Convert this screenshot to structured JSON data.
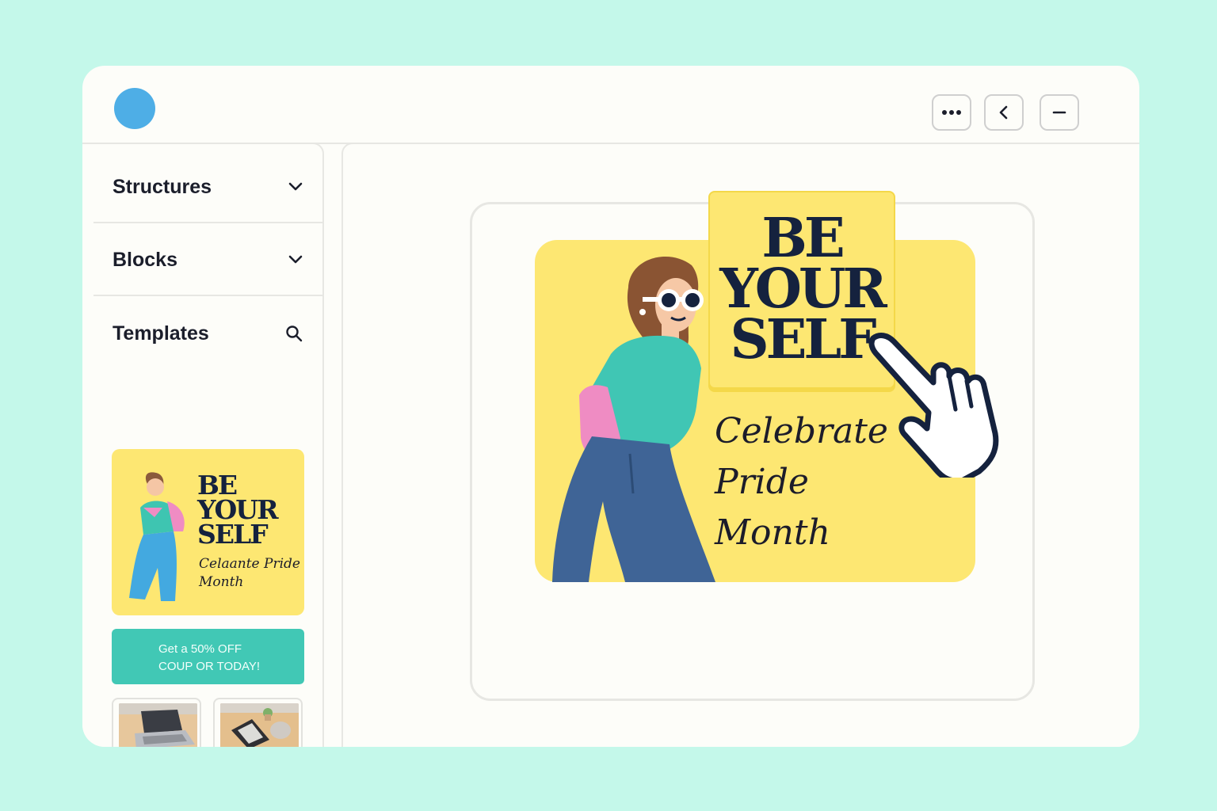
{
  "window": {
    "controls": [
      {
        "icon": "more-icon"
      },
      {
        "icon": "chevron-left-icon"
      },
      {
        "icon": "minus-icon"
      }
    ]
  },
  "sidebar": {
    "sections": [
      {
        "label": "Structures",
        "icon": "chevron-down-icon"
      },
      {
        "label": "Blocks",
        "icon": "chevron-down-icon"
      },
      {
        "label": "Templates",
        "icon": "search-icon"
      }
    ],
    "template_card": {
      "title": "BE YOUR SELF",
      "subtitle": "Celaante Pride Month"
    },
    "coupon": {
      "line1": "Get a 50% OFF",
      "line2": "COUP OR TODAY!"
    }
  },
  "canvas": {
    "design": {
      "title": "BE YOUR SELF",
      "subtitle": "Celebrate Pride Month"
    }
  },
  "colors": {
    "background": "#c4f8ea",
    "accent_yellow": "#fde772",
    "accent_teal": "#41c8b5",
    "navy": "#15223e",
    "brand_blue": "#4eaee6"
  }
}
